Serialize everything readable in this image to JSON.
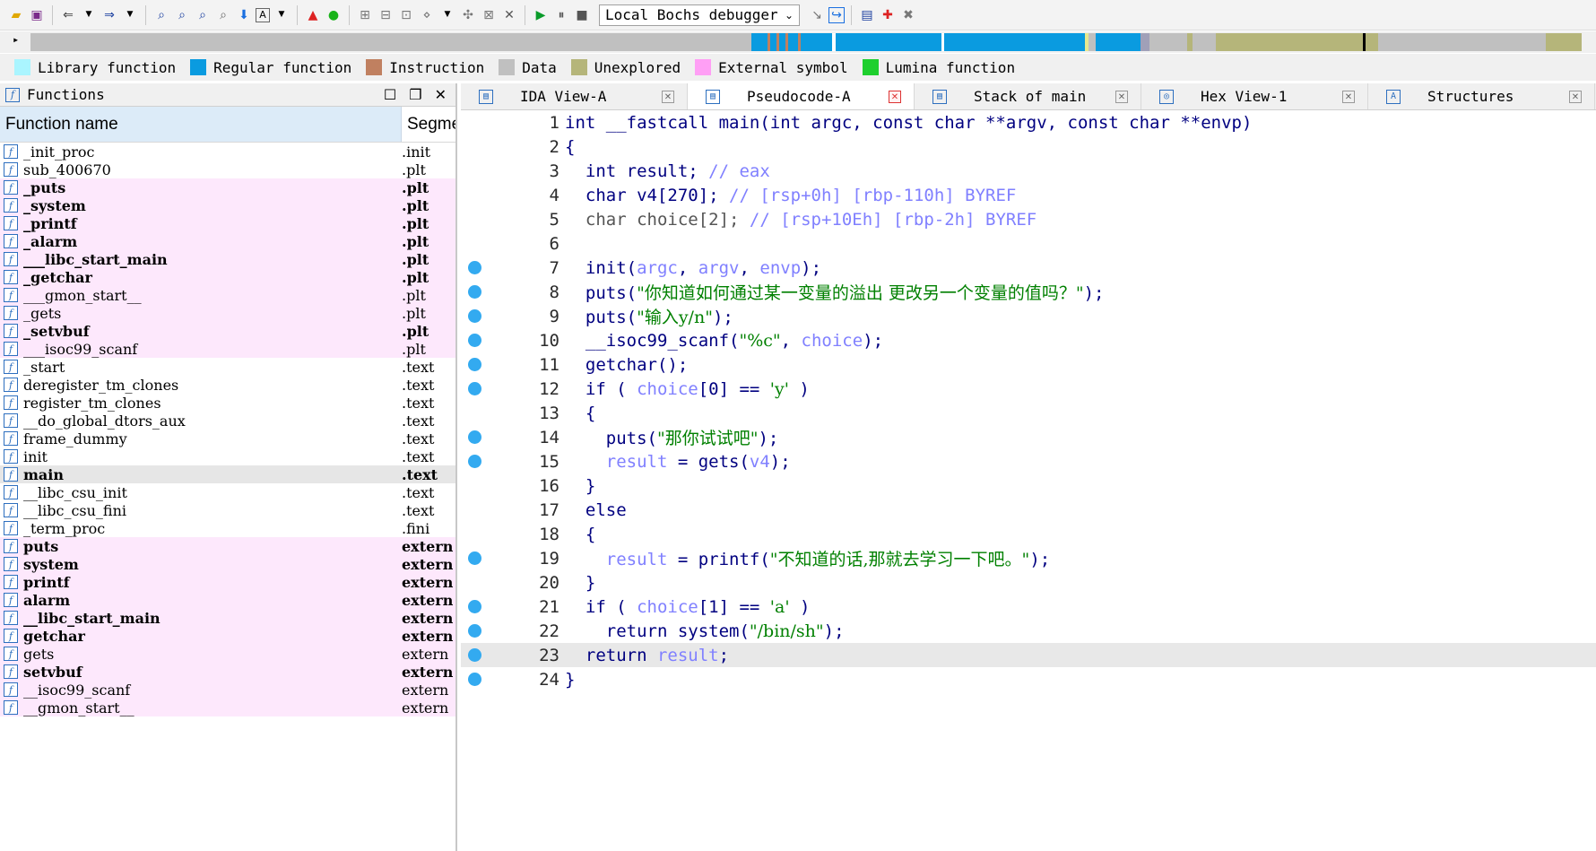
{
  "toolbar": {
    "debugger": "Local Bochs debugger"
  },
  "legend": [
    {
      "label": "Library function",
      "color": "#aaf5ff"
    },
    {
      "label": "Regular function",
      "color": "#0a9be0"
    },
    {
      "label": "Instruction",
      "color": "#c08060"
    },
    {
      "label": "Data",
      "color": "#c0c0c0"
    },
    {
      "label": "Unexplored",
      "color": "#b5b57a"
    },
    {
      "label": "External symbol",
      "color": "#ff9ff5"
    },
    {
      "label": "Lumina function",
      "color": "#1ecf2e"
    }
  ],
  "functions_panel": {
    "title": "Functions",
    "col_name": "Function name",
    "col_segment": "Segment",
    "rows": [
      {
        "name": "_init_proc",
        "segment": ".init",
        "kind": "lib",
        "bold": false
      },
      {
        "name": "sub_400670",
        "segment": ".plt",
        "kind": "lib",
        "bold": false
      },
      {
        "name": "_puts",
        "segment": ".plt",
        "kind": "ext",
        "bold": true
      },
      {
        "name": "_system",
        "segment": ".plt",
        "kind": "ext",
        "bold": true
      },
      {
        "name": "_printf",
        "segment": ".plt",
        "kind": "ext",
        "bold": true
      },
      {
        "name": "_alarm",
        "segment": ".plt",
        "kind": "ext",
        "bold": true
      },
      {
        "name": "___libc_start_main",
        "segment": ".plt",
        "kind": "ext",
        "bold": true
      },
      {
        "name": "_getchar",
        "segment": ".plt",
        "kind": "ext",
        "bold": true
      },
      {
        "name": "___gmon_start__",
        "segment": ".plt",
        "kind": "ext",
        "bold": false
      },
      {
        "name": "_gets",
        "segment": ".plt",
        "kind": "ext",
        "bold": false
      },
      {
        "name": "_setvbuf",
        "segment": ".plt",
        "kind": "ext",
        "bold": true
      },
      {
        "name": "___isoc99_scanf",
        "segment": ".plt",
        "kind": "ext",
        "bold": false
      },
      {
        "name": "_start",
        "segment": ".text",
        "kind": "lib",
        "bold": false
      },
      {
        "name": "deregister_tm_clones",
        "segment": ".text",
        "kind": "lib",
        "bold": false
      },
      {
        "name": "register_tm_clones",
        "segment": ".text",
        "kind": "lib",
        "bold": false
      },
      {
        "name": "__do_global_dtors_aux",
        "segment": ".text",
        "kind": "lib",
        "bold": false
      },
      {
        "name": "frame_dummy",
        "segment": ".text",
        "kind": "lib",
        "bold": false
      },
      {
        "name": "init",
        "segment": ".text",
        "kind": "lib",
        "bold": false
      },
      {
        "name": "main",
        "segment": ".text",
        "kind": "sel",
        "bold": true
      },
      {
        "name": "__libc_csu_init",
        "segment": ".text",
        "kind": "lib",
        "bold": false
      },
      {
        "name": "__libc_csu_fini",
        "segment": ".text",
        "kind": "lib",
        "bold": false
      },
      {
        "name": "_term_proc",
        "segment": ".fini",
        "kind": "lib",
        "bold": false
      },
      {
        "name": "puts",
        "segment": "extern",
        "kind": "ext",
        "bold": true
      },
      {
        "name": "system",
        "segment": "extern",
        "kind": "ext",
        "bold": true
      },
      {
        "name": "printf",
        "segment": "extern",
        "kind": "ext",
        "bold": true
      },
      {
        "name": "alarm",
        "segment": "extern",
        "kind": "ext",
        "bold": true
      },
      {
        "name": "__libc_start_main",
        "segment": "extern",
        "kind": "ext",
        "bold": true
      },
      {
        "name": "getchar",
        "segment": "extern",
        "kind": "ext",
        "bold": true
      },
      {
        "name": "gets",
        "segment": "extern",
        "kind": "ext",
        "bold": false
      },
      {
        "name": "setvbuf",
        "segment": "extern",
        "kind": "ext",
        "bold": true
      },
      {
        "name": "__isoc99_scanf",
        "segment": "extern",
        "kind": "ext",
        "bold": false
      },
      {
        "name": "__gmon_start__",
        "segment": "extern",
        "kind": "ext",
        "bold": false
      }
    ]
  },
  "tabs": [
    {
      "label": "IDA View-A",
      "active": false
    },
    {
      "label": "Pseudocode-A",
      "active": true
    },
    {
      "label": "Stack of main",
      "active": false
    },
    {
      "label": "Hex View-1",
      "active": false
    },
    {
      "label": "Structures",
      "active": false
    }
  ],
  "code": [
    {
      "n": "1",
      "bp": false,
      "hl": false,
      "t": [
        [
          "kw",
          "int __fastcall main(int argc, const char **argv, const char **envp)"
        ]
      ]
    },
    {
      "n": "2",
      "bp": false,
      "hl": false,
      "t": [
        [
          "pl",
          "{"
        ]
      ]
    },
    {
      "n": "3",
      "bp": false,
      "hl": false,
      "t": [
        [
          "pl",
          "  int result; "
        ],
        [
          "cm",
          "// eax"
        ]
      ]
    },
    {
      "n": "4",
      "bp": false,
      "hl": false,
      "t": [
        [
          "pl",
          "  char v4["
        ],
        [
          "pl",
          "270"
        ],
        [
          "pl",
          "]; "
        ],
        [
          "cm",
          "// [rsp+0h] [rbp-110h] BYREF"
        ]
      ]
    },
    {
      "n": "5",
      "bp": false,
      "hl": false,
      "t": [
        [
          "gy",
          "  char choice[2]; "
        ],
        [
          "cm",
          "// [rsp+10Eh] [rbp-2h] BYREF"
        ]
      ]
    },
    {
      "n": "6",
      "bp": false,
      "hl": false,
      "t": [
        [
          "pl",
          ""
        ]
      ]
    },
    {
      "n": "7",
      "bp": true,
      "hl": false,
      "t": [
        [
          "pl",
          "  init("
        ],
        [
          "var",
          "argc"
        ],
        [
          "pl",
          ", "
        ],
        [
          "var",
          "argv"
        ],
        [
          "pl",
          ", "
        ],
        [
          "var",
          "envp"
        ],
        [
          "pl",
          ");"
        ]
      ]
    },
    {
      "n": "8",
      "bp": true,
      "hl": false,
      "t": [
        [
          "pl",
          "  puts("
        ],
        [
          "str",
          "\"你知道如何通过某一变量的溢出 更改另一个变量的值吗？\""
        ],
        [
          "pl",
          ");"
        ]
      ]
    },
    {
      "n": "9",
      "bp": true,
      "hl": false,
      "t": [
        [
          "pl",
          "  puts("
        ],
        [
          "str",
          "\"输入y/n\""
        ],
        [
          "pl",
          ");"
        ]
      ]
    },
    {
      "n": "10",
      "bp": true,
      "hl": false,
      "t": [
        [
          "pl",
          "  __isoc99_scanf("
        ],
        [
          "str",
          "\"%c\""
        ],
        [
          "pl",
          ", "
        ],
        [
          "var",
          "choice"
        ],
        [
          "pl",
          ");"
        ]
      ]
    },
    {
      "n": "11",
      "bp": true,
      "hl": false,
      "t": [
        [
          "pl",
          "  getchar();"
        ]
      ]
    },
    {
      "n": "12",
      "bp": true,
      "hl": false,
      "t": [
        [
          "pl",
          "  if ( "
        ],
        [
          "var",
          "choice"
        ],
        [
          "pl",
          "[0] == "
        ],
        [
          "str",
          "'y'"
        ],
        [
          "pl",
          " )"
        ]
      ]
    },
    {
      "n": "13",
      "bp": false,
      "hl": false,
      "t": [
        [
          "pl",
          "  {"
        ]
      ]
    },
    {
      "n": "14",
      "bp": true,
      "hl": false,
      "t": [
        [
          "pl",
          "    puts("
        ],
        [
          "str",
          "\"那你试试吧\""
        ],
        [
          "pl",
          ");"
        ]
      ]
    },
    {
      "n": "15",
      "bp": true,
      "hl": false,
      "t": [
        [
          "var",
          "    result"
        ],
        [
          "pl",
          " = gets("
        ],
        [
          "var",
          "v4"
        ],
        [
          "pl",
          ");"
        ]
      ]
    },
    {
      "n": "16",
      "bp": false,
      "hl": false,
      "t": [
        [
          "pl",
          "  }"
        ]
      ]
    },
    {
      "n": "17",
      "bp": false,
      "hl": false,
      "t": [
        [
          "pl",
          "  else"
        ]
      ]
    },
    {
      "n": "18",
      "bp": false,
      "hl": false,
      "t": [
        [
          "pl",
          "  {"
        ]
      ]
    },
    {
      "n": "19",
      "bp": true,
      "hl": false,
      "t": [
        [
          "var",
          "    result"
        ],
        [
          "pl",
          " = printf("
        ],
        [
          "str",
          "\"不知道的话,那就去学习一下吧。\""
        ],
        [
          "pl",
          ");"
        ]
      ]
    },
    {
      "n": "20",
      "bp": false,
      "hl": false,
      "t": [
        [
          "pl",
          "  }"
        ]
      ]
    },
    {
      "n": "21",
      "bp": true,
      "hl": false,
      "t": [
        [
          "pl",
          "  if ( "
        ],
        [
          "var",
          "choice"
        ],
        [
          "pl",
          "[1] == "
        ],
        [
          "str",
          "'a'"
        ],
        [
          "pl",
          " )"
        ]
      ]
    },
    {
      "n": "22",
      "bp": true,
      "hl": false,
      "t": [
        [
          "pl",
          "    return system("
        ],
        [
          "str",
          "\"/bin/sh\""
        ],
        [
          "pl",
          ");"
        ]
      ]
    },
    {
      "n": "23",
      "bp": true,
      "hl": true,
      "t": [
        [
          "pl",
          "  return "
        ],
        [
          "var",
          "result"
        ],
        [
          "pl",
          ";"
        ]
      ]
    },
    {
      "n": "24",
      "bp": true,
      "hl": false,
      "t": [
        [
          "pl",
          "}"
        ]
      ]
    }
  ]
}
